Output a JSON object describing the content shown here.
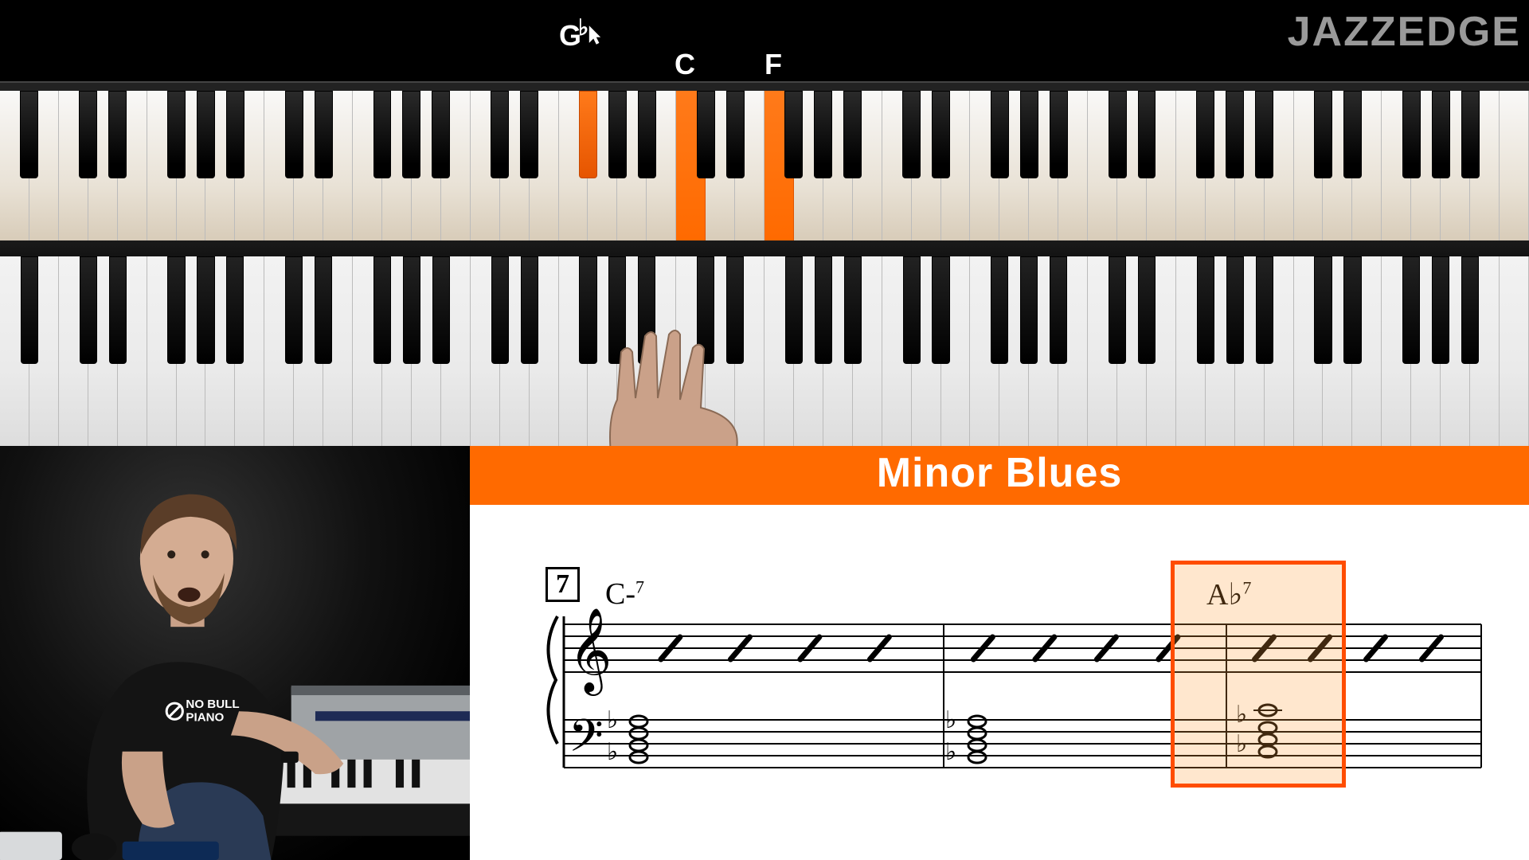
{
  "brand": "JAZZEDGE",
  "note_labels": {
    "gflat": "G",
    "c": "C",
    "f": "F"
  },
  "virtual_keyboard": {
    "white_key_count": 52,
    "highlighted_white_indices": [
      23,
      26
    ],
    "highlighted_black_note": "Gb4",
    "black_per_octave_offsets": [
      1,
      2,
      4,
      5,
      6
    ]
  },
  "real_keyboard": {
    "white_key_count": 52
  },
  "score": {
    "title": "Minor Blues",
    "rehearsal_mark": "7",
    "chord1": {
      "root": "C",
      "quality": "-",
      "ext": "7"
    },
    "chord2": {
      "root": "A",
      "acc": "♭",
      "ext": "7"
    },
    "highlight_measure_index": 2
  },
  "instructor": {
    "shirt_logo_line1": "NO BULL",
    "shirt_logo_line2": "PIANO"
  }
}
